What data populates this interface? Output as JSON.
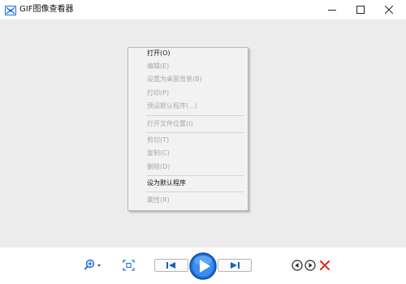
{
  "window": {
    "title": "GIF图像查看器",
    "controls": [
      "minimize",
      "maximize",
      "close"
    ]
  },
  "context_menu": {
    "items": [
      {
        "label": "打开(O)",
        "enabled": true
      },
      {
        "label": "编辑(E)",
        "enabled": false
      },
      {
        "label": "设置为桌面背景(B)",
        "enabled": false
      },
      {
        "label": "打印(P)",
        "enabled": false
      },
      {
        "label": "预设默认程序(...)",
        "enabled": false
      },
      {
        "label": "打开文件位置(I)",
        "enabled": false
      },
      {
        "label": "剪切(T)",
        "enabled": false
      },
      {
        "label": "复制(C)",
        "enabled": false
      },
      {
        "label": "删除(D)",
        "enabled": false
      },
      {
        "label": "设为默认程序",
        "enabled": true
      },
      {
        "label": "属性(R)",
        "enabled": false
      }
    ]
  },
  "toolbar": {
    "buttons": [
      {
        "name": "zoom-dropdown",
        "icon": "magnifier-icon"
      },
      {
        "name": "actual-size",
        "icon": "fit-to-window-icon"
      },
      {
        "name": "previous",
        "icon": "skip-previous-icon"
      },
      {
        "name": "play",
        "icon": "play-icon"
      },
      {
        "name": "next",
        "icon": "skip-next-icon"
      },
      {
        "name": "rotate-counterclockwise",
        "icon": "rotate-left-icon"
      },
      {
        "name": "rotate-clockwise",
        "icon": "rotate-right-icon"
      },
      {
        "name": "delete",
        "icon": "delete-x-icon"
      }
    ],
    "accent": "#1e6fd9",
    "delete_color": "#d9302c"
  }
}
